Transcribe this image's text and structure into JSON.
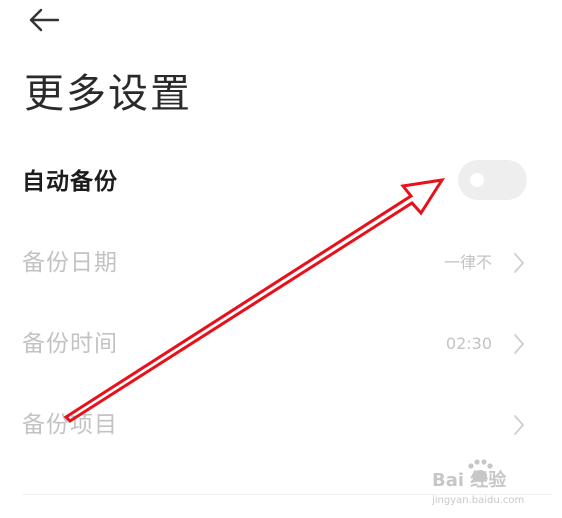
{
  "header": {
    "back_icon": "arrow-left-icon",
    "title": "更多设置"
  },
  "settings": {
    "auto_backup": {
      "label": "自动备份",
      "toggle_on": false
    },
    "backup_date": {
      "label": "备份日期",
      "value": "一律不"
    },
    "backup_time": {
      "label": "备份时间",
      "value": "02:30"
    },
    "backup_items": {
      "label": "备份项目"
    }
  },
  "colors": {
    "title_text": "#2a2a2a",
    "active_text": "#1c1c1c",
    "disabled_text": "#c3c3c3",
    "toggle_track": "#eeeeee",
    "annotation_arrow": "#e8101a"
  },
  "watermark": {
    "text": "Bai 经验",
    "url": "jingyan.baidu.com"
  }
}
